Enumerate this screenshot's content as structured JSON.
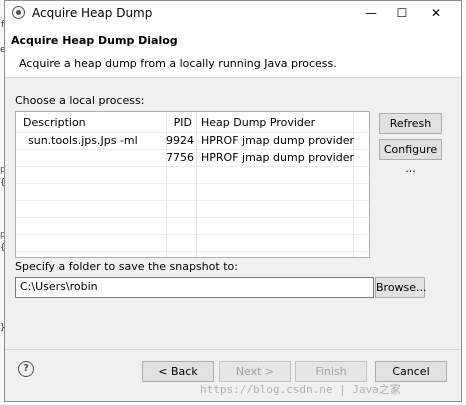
{
  "editor_margin": {
    "chars": [
      "f",
      "e",
      "p",
      "{",
      "p",
      "{",
      "}"
    ]
  },
  "window": {
    "title": "Acquire Heap Dump",
    "minimize": "—",
    "maximize": "☐",
    "close": "✕"
  },
  "banner": {
    "title": "Acquire Heap Dump Dialog",
    "description": "Acquire a heap dump from a locally running Java process."
  },
  "process_section": {
    "label": "Choose a local process:"
  },
  "table": {
    "columns": [
      "Description",
      "PID",
      "Heap Dump Provider"
    ],
    "rows": [
      {
        "description": "sun.tools.jps.Jps -ml",
        "pid": "9924",
        "provider": "HPROF jmap dump provider"
      },
      {
        "description": "",
        "pid": "7756",
        "provider": "HPROF jmap dump provider"
      }
    ]
  },
  "side_buttons": {
    "refresh": "Refresh",
    "configure": "Configure ..."
  },
  "folder": {
    "label": "Specify a folder to save the snapshot to:",
    "value": "C:\\Users\\robin",
    "browse": "Browse..."
  },
  "footer": {
    "back": "< Back",
    "next": "Next >",
    "finish": "Finish",
    "cancel": "Cancel",
    "help_icon": "?"
  },
  "watermark": {
    "text": "https://blog.csdn.ne  | Java之家"
  }
}
